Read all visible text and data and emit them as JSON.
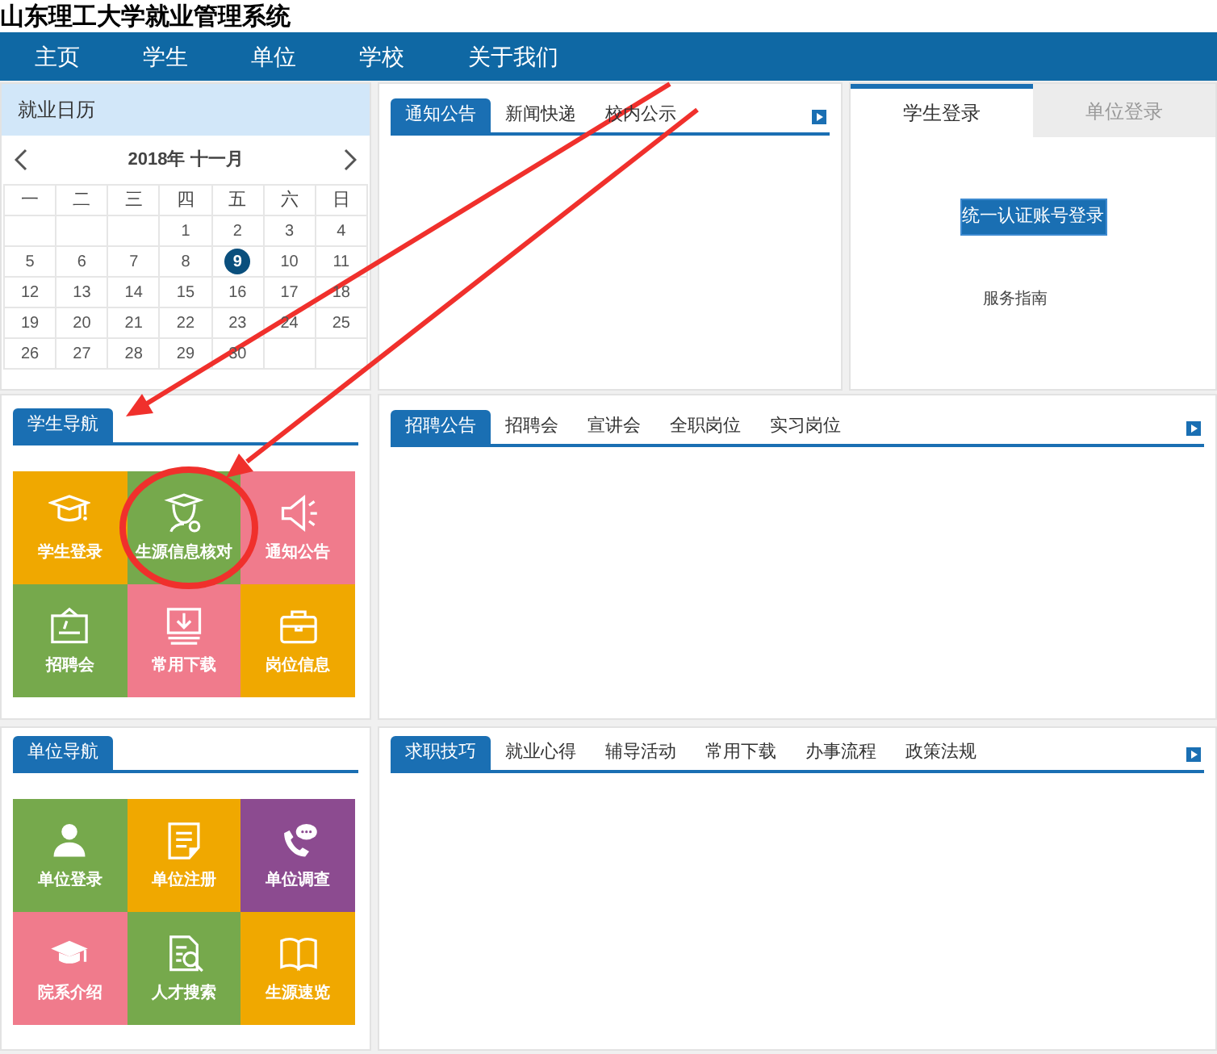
{
  "site_title": "山东理工大学就业管理系统",
  "nav": [
    {
      "label": "主页"
    },
    {
      "label": "学生"
    },
    {
      "label": "单位"
    },
    {
      "label": "学校"
    },
    {
      "label": "关于我们"
    }
  ],
  "calendar": {
    "title": "就业日历",
    "month_label": "2018年 十一月",
    "weekdays": [
      "一",
      "二",
      "三",
      "四",
      "五",
      "六",
      "日"
    ],
    "days": [
      {
        "kind": "blank"
      },
      {
        "kind": "blank"
      },
      {
        "kind": "blank"
      },
      {
        "kind": "day",
        "label": "1",
        "selected": false
      },
      {
        "kind": "day",
        "label": "2",
        "selected": false
      },
      {
        "kind": "day",
        "label": "3",
        "selected": false
      },
      {
        "kind": "day",
        "label": "4",
        "selected": false
      },
      {
        "kind": "day",
        "label": "5",
        "selected": false
      },
      {
        "kind": "day",
        "label": "6",
        "selected": false
      },
      {
        "kind": "day",
        "label": "7",
        "selected": false
      },
      {
        "kind": "day",
        "label": "8",
        "selected": false
      },
      {
        "kind": "day",
        "label": "9",
        "selected": true
      },
      {
        "kind": "day",
        "label": "10",
        "selected": false
      },
      {
        "kind": "day",
        "label": "11",
        "selected": false
      },
      {
        "kind": "day",
        "label": "12",
        "selected": false
      },
      {
        "kind": "day",
        "label": "13",
        "selected": false
      },
      {
        "kind": "day",
        "label": "14",
        "selected": false
      },
      {
        "kind": "day",
        "label": "15",
        "selected": false
      },
      {
        "kind": "day",
        "label": "16",
        "selected": false
      },
      {
        "kind": "day",
        "label": "17",
        "selected": false
      },
      {
        "kind": "day",
        "label": "18",
        "selected": false
      },
      {
        "kind": "day",
        "label": "19",
        "selected": false
      },
      {
        "kind": "day",
        "label": "20",
        "selected": false
      },
      {
        "kind": "day",
        "label": "21",
        "selected": false
      },
      {
        "kind": "day",
        "label": "22",
        "selected": false
      },
      {
        "kind": "day",
        "label": "23",
        "selected": false
      },
      {
        "kind": "day",
        "label": "24",
        "selected": false
      },
      {
        "kind": "day",
        "label": "25",
        "selected": false
      },
      {
        "kind": "day",
        "label": "26",
        "selected": false
      },
      {
        "kind": "day",
        "label": "27",
        "selected": false
      },
      {
        "kind": "day",
        "label": "28",
        "selected": false
      },
      {
        "kind": "day",
        "label": "29",
        "selected": false
      },
      {
        "kind": "day",
        "label": "30",
        "selected": false
      },
      {
        "kind": "blank"
      },
      {
        "kind": "blank"
      }
    ]
  },
  "student_nav": {
    "title": "学生导航",
    "tiles": [
      {
        "label": "学生登录",
        "color": "#f0a800",
        "kind": "cap"
      },
      {
        "label": "生源信息核对",
        "color": "#76a94c",
        "kind": "graduate"
      },
      {
        "label": "通知公告",
        "color": "#f07b8c",
        "kind": "megaphone"
      },
      {
        "label": "招聘会",
        "color": "#76a94c",
        "kind": "job"
      },
      {
        "label": "常用下载",
        "color": "#f07b8c",
        "kind": "download"
      },
      {
        "label": "岗位信息",
        "color": "#f0a800",
        "kind": "briefcase"
      }
    ]
  },
  "unit_nav": {
    "title": "单位导航",
    "tiles": [
      {
        "label": "单位登录",
        "color": "#76a94c",
        "kind": "person"
      },
      {
        "label": "单位注册",
        "color": "#f0a800",
        "kind": "document"
      },
      {
        "label": "单位调查",
        "color": "#8c4b90",
        "kind": "phone"
      },
      {
        "label": "院系介绍",
        "color": "#f07b8c",
        "kind": "mortarboard"
      },
      {
        "label": "人才搜索",
        "color": "#76a94c",
        "kind": "search"
      },
      {
        "label": "生源速览",
        "color": "#f0a800",
        "kind": "book"
      }
    ]
  },
  "notice_panel": {
    "tabs": [
      {
        "label": "通知公告",
        "selected": true
      },
      {
        "label": "新闻快递",
        "selected": false
      },
      {
        "label": "校内公示",
        "selected": false
      }
    ]
  },
  "login_panel": {
    "tabs": [
      {
        "label": "学生登录",
        "selected": true
      },
      {
        "label": "单位登录",
        "selected": false
      }
    ],
    "button": "统一认证账号登录",
    "link": "服务指南"
  },
  "recruit_panel": {
    "tabs": [
      {
        "label": "招聘公告",
        "selected": true
      },
      {
        "label": "招聘会",
        "selected": false
      },
      {
        "label": "宣讲会",
        "selected": false
      },
      {
        "label": "全职岗位",
        "selected": false
      },
      {
        "label": "实习岗位",
        "selected": false
      }
    ]
  },
  "tips_panel": {
    "tabs": [
      {
        "label": "求职技巧",
        "selected": true
      },
      {
        "label": "就业心得",
        "selected": false
      },
      {
        "label": "辅导活动",
        "selected": false
      },
      {
        "label": "常用下载",
        "selected": false
      },
      {
        "label": "办事流程",
        "selected": false
      },
      {
        "label": "政策法规",
        "selected": false
      }
    ]
  },
  "annotations": [
    {
      "kind": "arrow"
    },
    {
      "kind": "arrow"
    },
    {
      "kind": "circle"
    }
  ]
}
